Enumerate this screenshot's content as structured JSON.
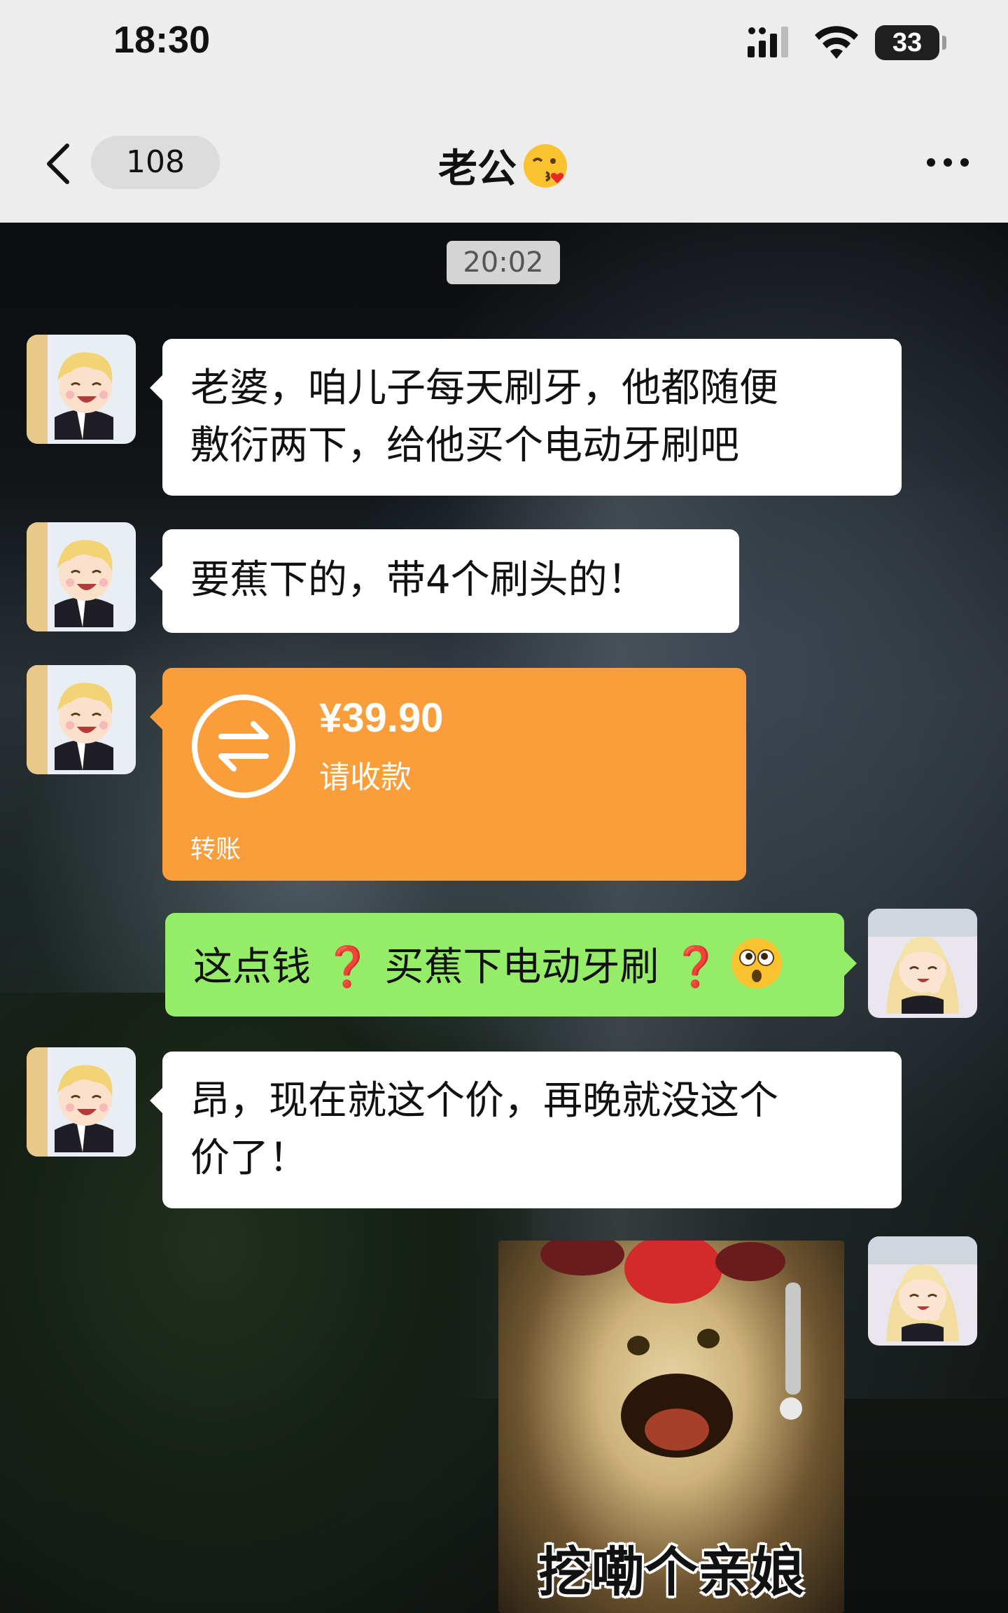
{
  "status_bar": {
    "time": "18:30",
    "battery_level": "33",
    "icons": [
      "signal-icon",
      "wifi-icon",
      "battery-icon"
    ]
  },
  "nav": {
    "back_icon": "chevron-left-icon",
    "unread_count": "108",
    "title": "老公",
    "title_emoji": "kissing-face-emoji",
    "more_icon": "more-dots-icon"
  },
  "chat": {
    "timestamp": "20:02",
    "messages": [
      {
        "sender": "husband",
        "type": "text",
        "lines": [
          "老婆，咱儿子每天刷牙，他都随便",
          "敷衍两下，给他买个电动牙刷吧"
        ]
      },
      {
        "sender": "husband",
        "type": "text",
        "lines": [
          "要蕉下的，带4个刷头的！"
        ]
      },
      {
        "sender": "husband",
        "type": "transfer",
        "amount": "¥39.90",
        "status": "请收款",
        "label": "转账"
      },
      {
        "sender": "me",
        "type": "text",
        "parts": [
          "这点钱",
          "❓",
          "买蕉下电动牙刷",
          "❓"
        ],
        "emoji": "flushed-face-emoji"
      },
      {
        "sender": "husband",
        "type": "text",
        "lines": [
          "昂，现在就这个价，再晚就没这个",
          "价了！"
        ]
      },
      {
        "sender": "me",
        "type": "sticker",
        "caption": "挖嘞个亲娘"
      }
    ]
  },
  "colors": {
    "header_bg": "#ededed",
    "incoming_bubble": "#ffffff",
    "outgoing_bubble": "#95ec69",
    "transfer_card": "#fa9d3b",
    "question_mark": "#e8262b"
  }
}
